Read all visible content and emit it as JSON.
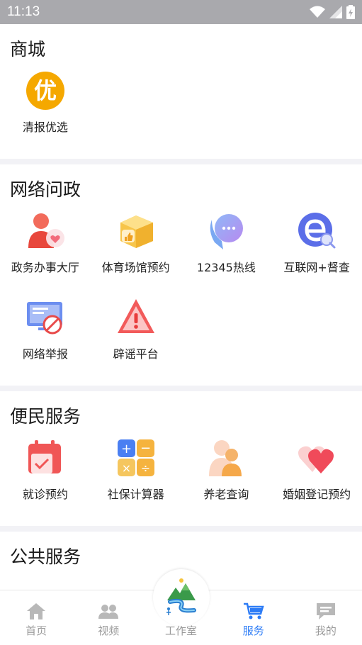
{
  "status": {
    "time": "11:13"
  },
  "sections": {
    "mall": {
      "title": "商城",
      "items": [
        {
          "label": "清报优选",
          "icon": "you-badge-icon",
          "glyph": "优"
        }
      ]
    },
    "network": {
      "title": "网络问政",
      "items": [
        {
          "label": "政务办事大厅",
          "icon": "person-heart-icon"
        },
        {
          "label": "体育场馆预约",
          "icon": "thumb-box-icon"
        },
        {
          "label": "12345热线",
          "icon": "chat-bubble-icon"
        },
        {
          "label": "互联网+督查",
          "icon": "e-search-icon"
        },
        {
          "label": "网络举报",
          "icon": "monitor-forbidden-icon"
        },
        {
          "label": "辟谣平台",
          "icon": "warning-triangle-icon"
        }
      ]
    },
    "civil": {
      "title": "便民服务",
      "items": [
        {
          "label": "就诊预约",
          "icon": "calendar-check-icon"
        },
        {
          "label": "社保计算器",
          "icon": "calculator-icon"
        },
        {
          "label": "养老查询",
          "icon": "elderly-people-icon"
        },
        {
          "label": "婚姻登记预约",
          "icon": "double-heart-icon"
        }
      ]
    },
    "public": {
      "title": "公共服务"
    }
  },
  "tabs": [
    {
      "label": "首页",
      "icon": "home-icon"
    },
    {
      "label": "视频",
      "icon": "people-icon"
    },
    {
      "label": "工作室",
      "icon": "studio-logo-icon"
    },
    {
      "label": "服务",
      "icon": "cart-icon",
      "active": true
    },
    {
      "label": "我的",
      "icon": "message-icon"
    }
  ],
  "colors": {
    "accent": "#2d7cf6",
    "inactive": "#9a9a9a"
  }
}
